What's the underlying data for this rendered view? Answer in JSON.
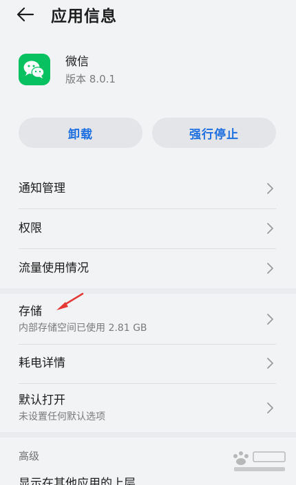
{
  "header": {
    "title": "应用信息",
    "back_icon": "arrow-left-icon"
  },
  "app": {
    "name": "微信",
    "version": "版本 8.0.1",
    "icon": "wechat-logo-icon",
    "icon_color": "#07c160"
  },
  "actions": {
    "uninstall_label": "卸载",
    "force_stop_label": "强行停止",
    "accent_color": "#1d6fe0"
  },
  "settings": {
    "notification_label": "通知管理",
    "permissions_label": "权限",
    "data_usage_label": "流量使用情况",
    "storage_label": "存储",
    "storage_sub": "内部存储空间已使用 2.81 GB",
    "battery_label": "耗电详情",
    "default_open_label": "默认打开",
    "default_open_sub": "未设置任何默认选项",
    "advanced_section": "高级",
    "overlay_label": "显示在其他应用的上层"
  }
}
